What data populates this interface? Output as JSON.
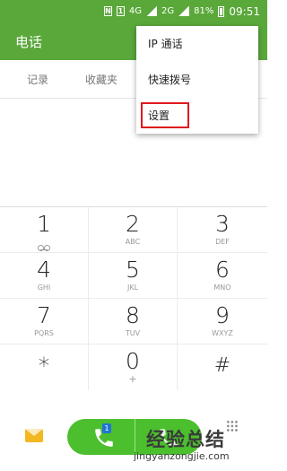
{
  "status_bar": {
    "icons": [
      "n-badge-icon",
      "sim-1-icon",
      "4g-icon",
      "signal-icon",
      "battery-icon"
    ],
    "network": "4G",
    "signal_label": "2G",
    "battery": "81%",
    "time": "09:51"
  },
  "app_bar": {
    "title": "电话"
  },
  "tabs": [
    {
      "label": "记录"
    },
    {
      "label": "收藏夹"
    }
  ],
  "keypad": [
    {
      "digit": "1",
      "sub": "",
      "icon": "voicemail-icon"
    },
    {
      "digit": "2",
      "sub": "ABC"
    },
    {
      "digit": "3",
      "sub": "DEF"
    },
    {
      "digit": "4",
      "sub": "GHI"
    },
    {
      "digit": "5",
      "sub": "JKL"
    },
    {
      "digit": "6",
      "sub": "MNO"
    },
    {
      "digit": "7",
      "sub": "PQRS"
    },
    {
      "digit": "8",
      "sub": "TUV"
    },
    {
      "digit": "9",
      "sub": "WXYZ"
    },
    {
      "digit": "*",
      "sub": ""
    },
    {
      "digit": "0",
      "sub": "+"
    },
    {
      "digit": "#",
      "sub": ""
    }
  ],
  "bottom_bar": {
    "sim_badge": "1",
    "icons": [
      "message-icon",
      "phone-call-icon",
      "more-icon"
    ]
  },
  "menu": {
    "items": [
      {
        "label": "IP 通话"
      },
      {
        "label": "快速拨号"
      },
      {
        "label": "设置"
      }
    ],
    "highlighted_item": "设置"
  },
  "watermark": {
    "logo": "经验总结",
    "url": "jingyanzongjie.com"
  },
  "colors": {
    "accent": "#5aa83a",
    "call_button": "#4bbf2e",
    "highlight": "#e0191e",
    "sim_badge": "#1e74d6"
  }
}
